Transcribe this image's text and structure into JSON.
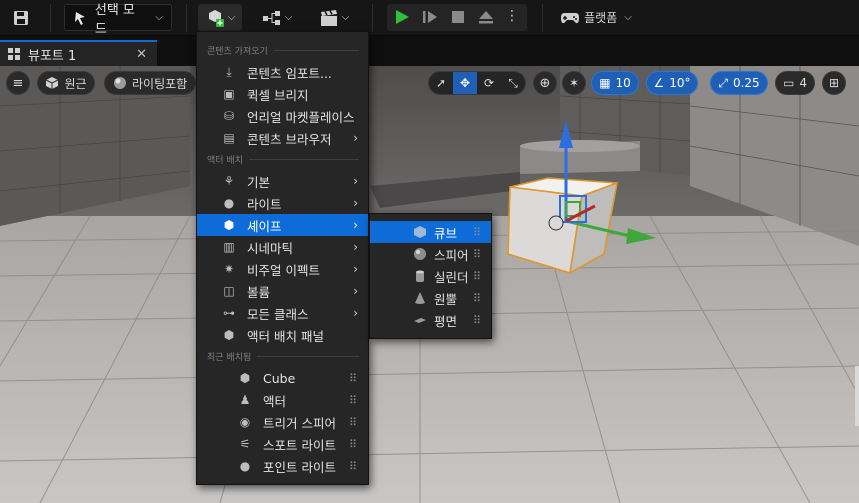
{
  "toolbar": {
    "mode_label": "선택 모드",
    "platform_label": "플랫폼"
  },
  "tab": {
    "label": "뷰포트 1"
  },
  "viewport_bar": {
    "perspective": "원근",
    "lighting": "라이팅포함",
    "grid_snap": "10",
    "angle_snap": "10°",
    "scale_snap": "0.25",
    "camera_speed": "4"
  },
  "menu": {
    "sections": {
      "import": "콘텐츠 가져오기",
      "place": "액터 배치",
      "recent": "최근 배치됨"
    },
    "import_items": [
      "콘텐츠 임포트...",
      "퀵셀 브리지",
      "언리얼 마켓플레이스",
      "콘텐츠 브라우저"
    ],
    "place_items": [
      "기본",
      "라이트",
      "셰이프",
      "시네마틱",
      "비주얼 이펙트",
      "볼륨",
      "모든 클래스",
      "액터 배치 패널"
    ],
    "recent_items": [
      "Cube",
      "액터",
      "트리거 스피어",
      "스포트 라이트",
      "포인트 라이트"
    ]
  },
  "submenu": {
    "items": [
      "큐브",
      "스피어",
      "실린더",
      "원뿔",
      "평면"
    ]
  },
  "colors": {
    "accent": "#0e6cd8",
    "play_green": "#2fbf3a",
    "gizmo_blue": "#2a6fe0",
    "gizmo_green": "#3ea83a",
    "selection_orange": "#e0962a"
  }
}
